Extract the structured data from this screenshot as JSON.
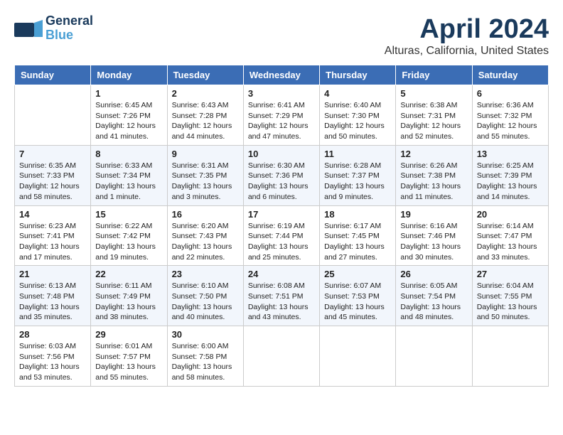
{
  "header": {
    "logo_line1": "General",
    "logo_line2": "Blue",
    "title": "April 2024",
    "subtitle": "Alturas, California, United States"
  },
  "columns": [
    "Sunday",
    "Monday",
    "Tuesday",
    "Wednesday",
    "Thursday",
    "Friday",
    "Saturday"
  ],
  "weeks": [
    [
      {
        "day": "",
        "sunrise": "",
        "sunset": "",
        "daylight": ""
      },
      {
        "day": "1",
        "sunrise": "Sunrise: 6:45 AM",
        "sunset": "Sunset: 7:26 PM",
        "daylight": "Daylight: 12 hours and 41 minutes."
      },
      {
        "day": "2",
        "sunrise": "Sunrise: 6:43 AM",
        "sunset": "Sunset: 7:28 PM",
        "daylight": "Daylight: 12 hours and 44 minutes."
      },
      {
        "day": "3",
        "sunrise": "Sunrise: 6:41 AM",
        "sunset": "Sunset: 7:29 PM",
        "daylight": "Daylight: 12 hours and 47 minutes."
      },
      {
        "day": "4",
        "sunrise": "Sunrise: 6:40 AM",
        "sunset": "Sunset: 7:30 PM",
        "daylight": "Daylight: 12 hours and 50 minutes."
      },
      {
        "day": "5",
        "sunrise": "Sunrise: 6:38 AM",
        "sunset": "Sunset: 7:31 PM",
        "daylight": "Daylight: 12 hours and 52 minutes."
      },
      {
        "day": "6",
        "sunrise": "Sunrise: 6:36 AM",
        "sunset": "Sunset: 7:32 PM",
        "daylight": "Daylight: 12 hours and 55 minutes."
      }
    ],
    [
      {
        "day": "7",
        "sunrise": "Sunrise: 6:35 AM",
        "sunset": "Sunset: 7:33 PM",
        "daylight": "Daylight: 12 hours and 58 minutes."
      },
      {
        "day": "8",
        "sunrise": "Sunrise: 6:33 AM",
        "sunset": "Sunset: 7:34 PM",
        "daylight": "Daylight: 13 hours and 1 minute."
      },
      {
        "day": "9",
        "sunrise": "Sunrise: 6:31 AM",
        "sunset": "Sunset: 7:35 PM",
        "daylight": "Daylight: 13 hours and 3 minutes."
      },
      {
        "day": "10",
        "sunrise": "Sunrise: 6:30 AM",
        "sunset": "Sunset: 7:36 PM",
        "daylight": "Daylight: 13 hours and 6 minutes."
      },
      {
        "day": "11",
        "sunrise": "Sunrise: 6:28 AM",
        "sunset": "Sunset: 7:37 PM",
        "daylight": "Daylight: 13 hours and 9 minutes."
      },
      {
        "day": "12",
        "sunrise": "Sunrise: 6:26 AM",
        "sunset": "Sunset: 7:38 PM",
        "daylight": "Daylight: 13 hours and 11 minutes."
      },
      {
        "day": "13",
        "sunrise": "Sunrise: 6:25 AM",
        "sunset": "Sunset: 7:39 PM",
        "daylight": "Daylight: 13 hours and 14 minutes."
      }
    ],
    [
      {
        "day": "14",
        "sunrise": "Sunrise: 6:23 AM",
        "sunset": "Sunset: 7:41 PM",
        "daylight": "Daylight: 13 hours and 17 minutes."
      },
      {
        "day": "15",
        "sunrise": "Sunrise: 6:22 AM",
        "sunset": "Sunset: 7:42 PM",
        "daylight": "Daylight: 13 hours and 19 minutes."
      },
      {
        "day": "16",
        "sunrise": "Sunrise: 6:20 AM",
        "sunset": "Sunset: 7:43 PM",
        "daylight": "Daylight: 13 hours and 22 minutes."
      },
      {
        "day": "17",
        "sunrise": "Sunrise: 6:19 AM",
        "sunset": "Sunset: 7:44 PM",
        "daylight": "Daylight: 13 hours and 25 minutes."
      },
      {
        "day": "18",
        "sunrise": "Sunrise: 6:17 AM",
        "sunset": "Sunset: 7:45 PM",
        "daylight": "Daylight: 13 hours and 27 minutes."
      },
      {
        "day": "19",
        "sunrise": "Sunrise: 6:16 AM",
        "sunset": "Sunset: 7:46 PM",
        "daylight": "Daylight: 13 hours and 30 minutes."
      },
      {
        "day": "20",
        "sunrise": "Sunrise: 6:14 AM",
        "sunset": "Sunset: 7:47 PM",
        "daylight": "Daylight: 13 hours and 33 minutes."
      }
    ],
    [
      {
        "day": "21",
        "sunrise": "Sunrise: 6:13 AM",
        "sunset": "Sunset: 7:48 PM",
        "daylight": "Daylight: 13 hours and 35 minutes."
      },
      {
        "day": "22",
        "sunrise": "Sunrise: 6:11 AM",
        "sunset": "Sunset: 7:49 PM",
        "daylight": "Daylight: 13 hours and 38 minutes."
      },
      {
        "day": "23",
        "sunrise": "Sunrise: 6:10 AM",
        "sunset": "Sunset: 7:50 PM",
        "daylight": "Daylight: 13 hours and 40 minutes."
      },
      {
        "day": "24",
        "sunrise": "Sunrise: 6:08 AM",
        "sunset": "Sunset: 7:51 PM",
        "daylight": "Daylight: 13 hours and 43 minutes."
      },
      {
        "day": "25",
        "sunrise": "Sunrise: 6:07 AM",
        "sunset": "Sunset: 7:53 PM",
        "daylight": "Daylight: 13 hours and 45 minutes."
      },
      {
        "day": "26",
        "sunrise": "Sunrise: 6:05 AM",
        "sunset": "Sunset: 7:54 PM",
        "daylight": "Daylight: 13 hours and 48 minutes."
      },
      {
        "day": "27",
        "sunrise": "Sunrise: 6:04 AM",
        "sunset": "Sunset: 7:55 PM",
        "daylight": "Daylight: 13 hours and 50 minutes."
      }
    ],
    [
      {
        "day": "28",
        "sunrise": "Sunrise: 6:03 AM",
        "sunset": "Sunset: 7:56 PM",
        "daylight": "Daylight: 13 hours and 53 minutes."
      },
      {
        "day": "29",
        "sunrise": "Sunrise: 6:01 AM",
        "sunset": "Sunset: 7:57 PM",
        "daylight": "Daylight: 13 hours and 55 minutes."
      },
      {
        "day": "30",
        "sunrise": "Sunrise: 6:00 AM",
        "sunset": "Sunset: 7:58 PM",
        "daylight": "Daylight: 13 hours and 58 minutes."
      },
      {
        "day": "",
        "sunrise": "",
        "sunset": "",
        "daylight": ""
      },
      {
        "day": "",
        "sunrise": "",
        "sunset": "",
        "daylight": ""
      },
      {
        "day": "",
        "sunrise": "",
        "sunset": "",
        "daylight": ""
      },
      {
        "day": "",
        "sunrise": "",
        "sunset": "",
        "daylight": ""
      }
    ]
  ]
}
